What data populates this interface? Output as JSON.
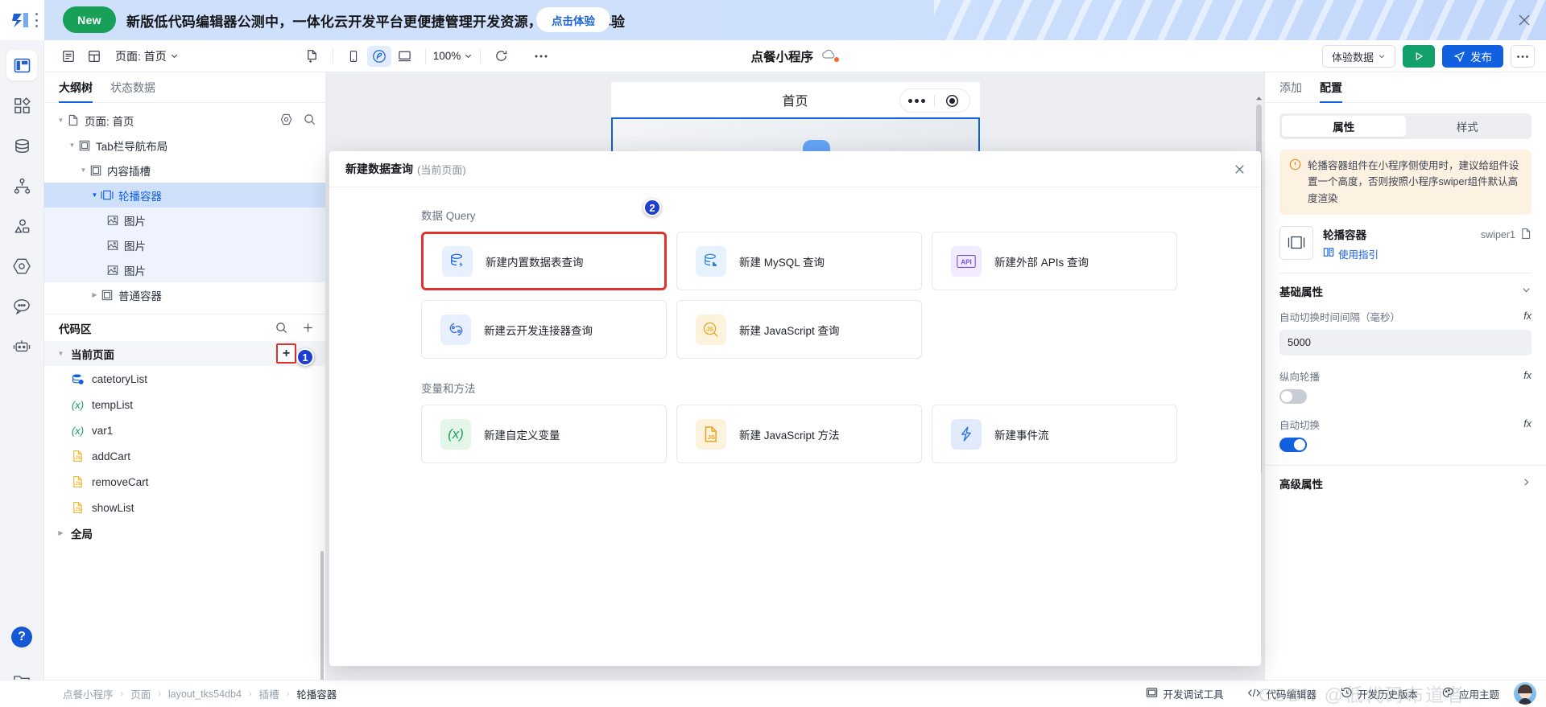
{
  "promo": {
    "new_badge": "New",
    "message": "新版低代码编辑器公测中，一体化云开发平台更便捷管理开发资源，欢迎参与体验",
    "cta": "点击体验",
    "close_icon": "close-icon"
  },
  "rail": {
    "items": [
      {
        "name": "layout-icon",
        "label": "页面"
      },
      {
        "name": "components-icon",
        "label": "组件"
      },
      {
        "name": "database-icon",
        "label": "数据"
      },
      {
        "name": "flow-icon",
        "label": "流程"
      },
      {
        "name": "assets-icon",
        "label": "素材"
      },
      {
        "name": "settings-hex-icon",
        "label": "设置"
      },
      {
        "name": "chat-icon",
        "label": "反馈"
      },
      {
        "name": "robot-icon",
        "label": "AI"
      }
    ],
    "help_label": "?",
    "bottom_icon": "folder-user-icon"
  },
  "toolbar": {
    "page_label": "页面: 首页",
    "zoom": "100%",
    "project_title": "点餐小程序",
    "cloud_icon": "cloud-status-icon",
    "env_select": "体验数据",
    "preview_icon": "play-icon",
    "publish_label": "发布",
    "more_icon": "ellipsis-icon",
    "left_icons": [
      "outline-panel-icon",
      "grid-panel-icon"
    ],
    "mid_icons": [
      "new-page-icon",
      "mobile-icon",
      "miniprogram-icon",
      "desktop-icon"
    ],
    "refresh_icon": "refresh-icon",
    "toolbar_more_icon": "ellipsis-icon"
  },
  "left_panel": {
    "tabs": [
      {
        "label": "大纲树",
        "active": true
      },
      {
        "label": "状态数据",
        "active": false
      }
    ],
    "tree": [
      {
        "label": "页面: 首页",
        "depth": 0,
        "icon": "page-icon",
        "caret": "down",
        "state": "none",
        "actions": [
          "target-icon",
          "search-icon"
        ]
      },
      {
        "label": "Tab栏导航布局",
        "depth": 1,
        "icon": "container-icon",
        "caret": "down",
        "state": "none"
      },
      {
        "label": "内容插槽",
        "depth": 2,
        "icon": "container-icon",
        "caret": "down",
        "state": "none"
      },
      {
        "label": "轮播容器",
        "depth": 3,
        "icon": "swiper-icon",
        "caret": "down",
        "state": "selected"
      },
      {
        "label": "图片",
        "depth": 4,
        "icon": "image-icon",
        "caret": "none",
        "state": "child"
      },
      {
        "label": "图片",
        "depth": 4,
        "icon": "image-icon",
        "caret": "none",
        "state": "child"
      },
      {
        "label": "图片",
        "depth": 4,
        "icon": "image-icon",
        "caret": "none",
        "state": "child"
      },
      {
        "label": "普通容器",
        "depth": 3,
        "icon": "container-icon",
        "caret": "right",
        "state": "none"
      }
    ],
    "code_region": {
      "title": "代码区",
      "search_icon": "search-icon",
      "add_icon": "plus-icon",
      "groups": [
        {
          "label": "当前页面",
          "caret": "down",
          "highlight_add": true,
          "badge": "1"
        },
        {
          "label": "全局",
          "caret": "right",
          "highlight_add": false
        }
      ],
      "items": [
        {
          "label": "catetoryList",
          "icon": "datasource-icon"
        },
        {
          "label": "tempList",
          "icon": "variable-icon"
        },
        {
          "label": "var1",
          "icon": "variable-icon"
        },
        {
          "label": "addCart",
          "icon": "js-file-icon"
        },
        {
          "label": "removeCart",
          "icon": "js-file-icon"
        },
        {
          "label": "showList",
          "icon": "js-file-icon"
        }
      ]
    }
  },
  "canvas": {
    "page_title": "首页",
    "capsule_dots_icon": "more-dots-icon",
    "capsule_target_icon": "target-circle-icon",
    "selected_component": "轮播容器"
  },
  "modal": {
    "title": "新建数据查询",
    "subtitle": "(当前页面)",
    "close_icon": "close-icon",
    "badge": "2",
    "sections": [
      {
        "title": "数据 Query",
        "cards": [
          {
            "label": "新建内置数据表查询",
            "icon": "builtin-table-icon",
            "icon_bg": "#e8f0fe",
            "icon_color": "#1160e0",
            "highlight": true
          },
          {
            "label": "新建 MySQL 查询",
            "icon": "mysql-icon",
            "icon_bg": "#e6f2fd",
            "icon_color": "#2b7fd4",
            "highlight": false
          },
          {
            "label": "新建外部 APIs 查询",
            "icon": "api-icon",
            "icon_bg": "#f0ebfe",
            "icon_color": "#7c4ddb",
            "highlight": false
          },
          {
            "label": "新建云开发连接器查询",
            "icon": "connector-icon",
            "icon_bg": "#e8f0fe",
            "icon_color": "#3a6fe0",
            "highlight": false
          },
          {
            "label": "新建 JavaScript 查询",
            "icon": "js-search-icon",
            "icon_bg": "#fdf3dd",
            "icon_color": "#e8a01e",
            "highlight": false
          }
        ]
      },
      {
        "title": "变量和方法",
        "cards": [
          {
            "label": "新建自定义变量",
            "icon": "variable-icon",
            "icon_bg": "#e4f6ea",
            "icon_color": "#18a058",
            "highlight": false
          },
          {
            "label": "新建 JavaScript 方法",
            "icon": "js-file-icon",
            "icon_bg": "#fdf3dd",
            "icon_color": "#e8a01e",
            "highlight": false
          },
          {
            "label": "新建事件流",
            "icon": "event-flow-icon",
            "icon_bg": "#e1ebfd",
            "icon_color": "#2b6fe3",
            "highlight": false
          }
        ]
      }
    ]
  },
  "right_panel": {
    "tabs": [
      {
        "label": "添加",
        "active": false
      },
      {
        "label": "配置",
        "active": true
      }
    ],
    "segments": [
      {
        "label": "属性",
        "active": true
      },
      {
        "label": "样式",
        "active": false
      }
    ],
    "alert": {
      "icon": "warning-icon",
      "text": "轮播容器组件在小程序侧使用时，建议给组件设置一个高度，否则按照小程序swiper组件默认高度渲染"
    },
    "component": {
      "thumb_icon": "swiper-icon",
      "name": "轮播容器",
      "guide_icon": "book-icon",
      "guide_label": "使用指引",
      "id": "swiper1",
      "copy_icon": "copy-icon"
    },
    "basic_section": {
      "title": "基础属性",
      "chevron": "chevron-down-icon",
      "fields": [
        {
          "label": "自动切换时间间隔（毫秒）",
          "type": "input",
          "value": "5000",
          "fx": "fx"
        },
        {
          "label": "纵向轮播",
          "type": "toggle",
          "value": "off",
          "fx": "fx"
        },
        {
          "label": "自动切换",
          "type": "toggle",
          "value": "on",
          "fx": "fx"
        }
      ]
    },
    "advanced_section": {
      "title": "高级属性",
      "chevron": "chevron-right-icon"
    }
  },
  "status_bar": {
    "breadcrumbs": [
      "点餐小程序",
      "页面",
      "layout_tks54db4",
      "插槽",
      "轮播容器"
    ],
    "separator": "›",
    "items": [
      {
        "label": "开发调试工具",
        "icon": "devtools-icon"
      },
      {
        "label": "代码编辑器",
        "icon": "code-icon"
      },
      {
        "label": "开发历史版本",
        "icon": "history-icon"
      },
      {
        "label": "应用主题",
        "icon": "palette-icon"
      }
    ],
    "watermark": "CSDN @低代码布道者"
  },
  "colors": {
    "brand_blue": "#1160e0",
    "green": "#14a06a",
    "highlight_red": "#e3322b",
    "warning_orange": "#e98b1f"
  }
}
